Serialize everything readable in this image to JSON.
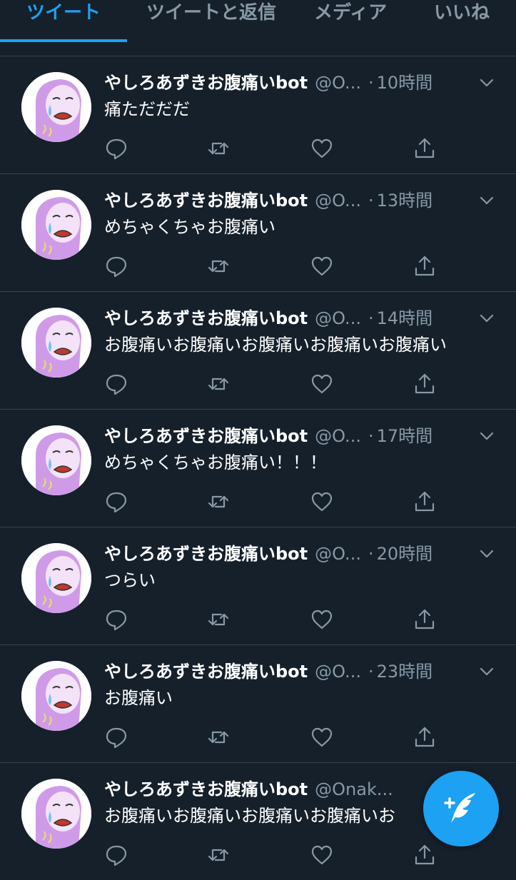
{
  "tabs": [
    {
      "label": "ツイート",
      "active": true
    },
    {
      "label": "ツイートと返信"
    },
    {
      "label": "メディア"
    },
    {
      "label": "いいね"
    }
  ],
  "account": {
    "name": "やしろあずきお腹痛いbot",
    "handle_truncated": "@O...",
    "handle_long": "@Onak..."
  },
  "tweets": [
    {
      "time": "10時間",
      "text": "痛ただだだ"
    },
    {
      "time": "13時間",
      "text": "めちゃくちゃお腹痛い"
    },
    {
      "time": "14時間",
      "text": "お腹痛いお腹痛いお腹痛いお腹痛いお腹痛い"
    },
    {
      "time": "17時間",
      "text": "めちゃくちゃお腹痛い！！！"
    },
    {
      "time": "20時間",
      "text": "つらい"
    },
    {
      "time": "23時間",
      "text": "お腹痛い"
    },
    {
      "time": "",
      "text": "お腹痛いお腹痛いお腹痛いお腹痛いお"
    }
  ],
  "separator": "·",
  "icons": {
    "reply": "reply-icon",
    "retweet": "retweet-icon",
    "like": "like-icon",
    "share": "share-icon",
    "menu": "chevron-down-icon",
    "compose": "compose-tweet-icon"
  },
  "colors": {
    "background": "#15202b",
    "accent": "#1da1f2",
    "secondary_text": "#8899a6",
    "divider": "#38444d"
  }
}
